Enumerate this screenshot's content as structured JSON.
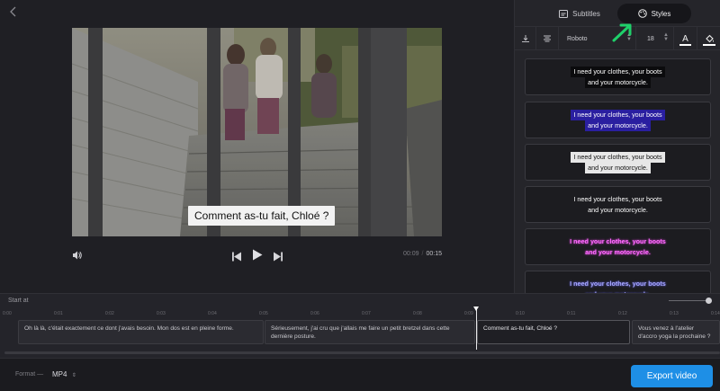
{
  "editor": {
    "back_icon": "chevron-left-icon",
    "subtitle_overlay": "Comment as-tu fait, Chloé ?",
    "time_current": "00:09",
    "time_separator": "/",
    "time_total": "00:15"
  },
  "panel": {
    "tabs": [
      {
        "label": "Subtitles",
        "icon": "subtitles-icon"
      },
      {
        "label": "Styles",
        "icon": "palette-icon"
      }
    ],
    "toolbar": {
      "font": "Roboto",
      "size": "18",
      "text_color_glyph": "A"
    },
    "preview_line1": "I need your clothes, your boots",
    "preview_line2": "and your motorcycle."
  },
  "timeline": {
    "start_at": "Start at",
    "ticks": [
      "0:00",
      "0:01",
      "0:02",
      "0:03",
      "0:04",
      "0:05",
      "0:06",
      "0:07",
      "0:08",
      "0:09",
      "0:10",
      "0:11",
      "0:12",
      "0:13",
      "0:14"
    ],
    "clips": [
      {
        "text": "Oh là là, c'était exactement ce dont j'avais besoin. Mon dos est en pleine forme."
      },
      {
        "text": "Sérieusement, j'ai cru que j'allais me faire un petit bretzel dans cette dernière posture."
      },
      {
        "text": "Comment as-tu fait, Chloé ?"
      },
      {
        "text": "Vous venez à l'atelier d'accro yoga la prochaine ?"
      }
    ]
  },
  "footer": {
    "format_label": "Format —",
    "format_value": "MP4",
    "export_label": "Export video"
  },
  "colors": {
    "accent": "#1e8fe6",
    "cursor_arrow": "#1fd06a"
  }
}
